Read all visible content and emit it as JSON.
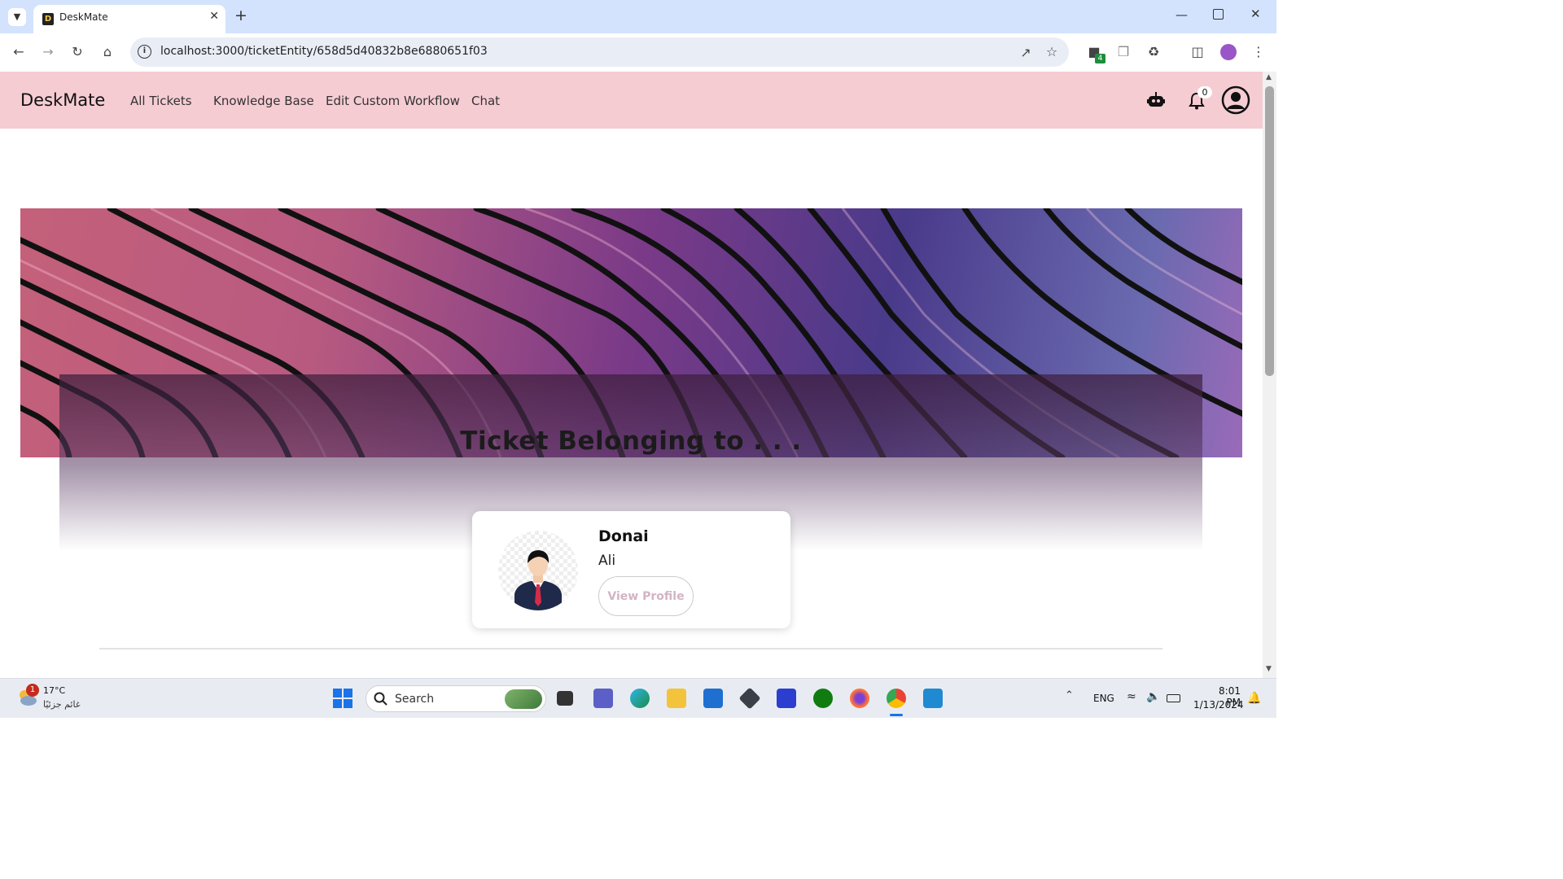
{
  "browser": {
    "tab_title": "DeskMate",
    "tab_favicon_letter": "D",
    "url": "localhost:3000/ticketEntity/658d5d40832b8e6880651f03",
    "extension_badge": "4"
  },
  "app": {
    "brand": "DeskMate",
    "nav": [
      "All Tickets",
      "Knowledge Base",
      "Edit Custom Workflow",
      "Chat"
    ],
    "notification_count": "0"
  },
  "ticket": {
    "heading": "Ticket Belonging to . . .",
    "owner_first_name": "Donai",
    "owner_last_name": "Ali",
    "view_profile_label": "View Profile"
  },
  "taskbar": {
    "weather_temp": "17°C",
    "weather_desc": "غائم جزئيًا",
    "weather_alert_count": "1",
    "search_label": "Search",
    "language": "ENG",
    "time": "8:01 PM",
    "date": "1/13/2024"
  },
  "colors": {
    "nav_bg": "#f6ccd3",
    "tab_strip": "#d3e3fd",
    "view_profile_text": "#d3b3c4"
  }
}
